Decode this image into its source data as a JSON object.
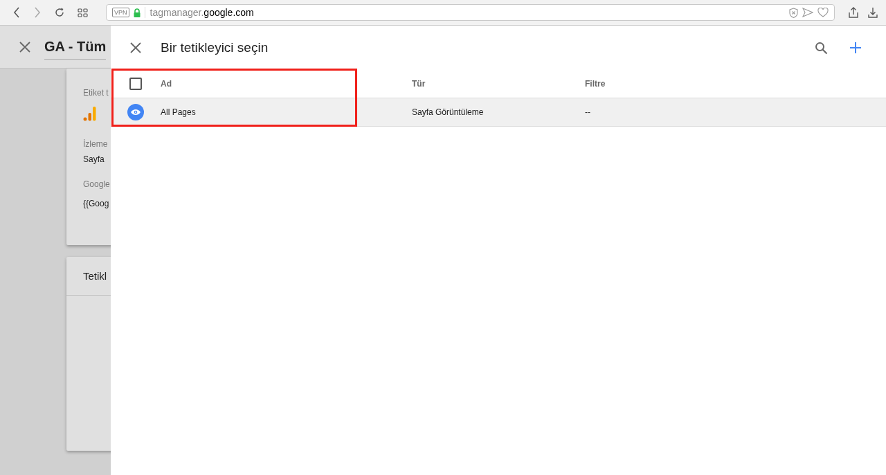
{
  "browser": {
    "vpn_label": "VPN",
    "url_subdomain": "tagmanager.",
    "url_domain": "google.com"
  },
  "background": {
    "title": "GA - Tüm",
    "card_1": {
      "fields": [
        {
          "kind": "icon",
          "label": "Etiket t"
        },
        {
          "kind": "value",
          "label": "İzleme",
          "value": "Sayfa"
        },
        {
          "kind": "value",
          "label": "Google",
          "value": "{{Goog"
        }
      ]
    },
    "card_2": {
      "title": "Tetikl"
    }
  },
  "panel": {
    "title": "Bir tetikleyici seçin",
    "select_all": {
      "checked": false
    },
    "columns": [
      "Ad",
      "Tür",
      "Filtre"
    ],
    "rows": [
      {
        "kind": "pageview",
        "selected": true,
        "name": "All Pages",
        "type": "Sayfa Görüntüleme",
        "filter": "--"
      }
    ],
    "highlighted": true
  }
}
